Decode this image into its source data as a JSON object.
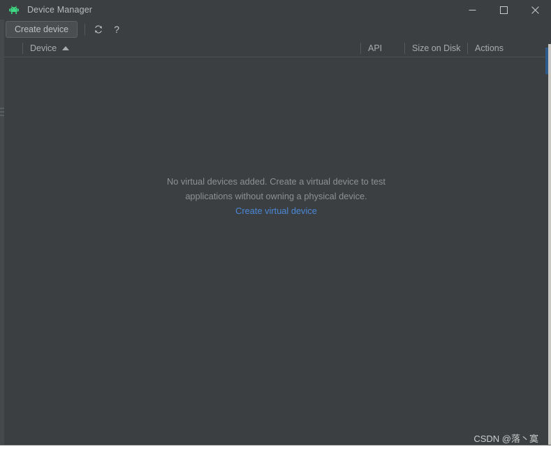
{
  "window": {
    "title": "Device Manager",
    "app_icon": "android-robot-icon",
    "controls": {
      "minimize": "minimize-icon",
      "maximize": "maximize-icon",
      "close": "close-icon"
    }
  },
  "toolbar": {
    "create_device_label": "Create device",
    "refresh_icon": "refresh-icon",
    "help_label": "?"
  },
  "table": {
    "columns": [
      {
        "key": "select",
        "label": ""
      },
      {
        "key": "device",
        "label": "Device",
        "sort": "ascending"
      },
      {
        "key": "api",
        "label": "API"
      },
      {
        "key": "size",
        "label": "Size on Disk"
      },
      {
        "key": "actions",
        "label": "Actions"
      }
    ],
    "rows": []
  },
  "empty_state": {
    "line1": "No virtual devices added. Create a virtual device to test",
    "line2": "applications without owning a physical device.",
    "link_label": "Create virtual device"
  },
  "watermark": {
    "text": "CSDN @落丶寞"
  },
  "colors": {
    "background": "#3c3f41",
    "text_primary": "#b9bcbd",
    "text_muted": "#8d9193",
    "link": "#4a88d8",
    "accent_blue": "#2f5a8c",
    "android_green": "#3ddc84"
  }
}
